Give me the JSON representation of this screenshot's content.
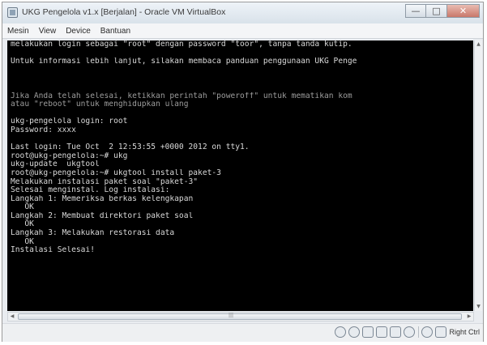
{
  "window": {
    "title": "UKG Pengelola v1.x [Berjalan] - Oracle VM VirtualBox",
    "minimize_icon": "minimize-icon",
    "maximize_icon": "maximize-icon",
    "close_icon": "close-icon"
  },
  "menu": {
    "items": [
      "Mesin",
      "View",
      "Device",
      "Bantuan"
    ]
  },
  "terminal": {
    "lines": [
      "melakukan login sebagai \"root\" dengan password \"toor\", tanpa tanda kutip.",
      "",
      "Untuk informasi lebih lanjut, silakan membaca panduan penggunaan UKG Penge",
      "",
      "",
      "",
      "Jika Anda telah selesai, ketikkan perintah \"poweroff\" untuk mematikan kom",
      "atau \"reboot\" untuk menghidupkan ulang",
      "",
      "ukg-pengelola login: root",
      "Password: xxxx",
      "",
      "Last login: Tue Oct  2 12:53:55 +0000 2012 on tty1.",
      "root@ukg-pengelola:~# ukg",
      "ukg-update  ukgtool",
      "root@ukg-pengelola:~# ukgtool install paket-3",
      "Melakukan instalasi paket soal \"paket-3\"",
      "Selesai menginstal. Log instalasi:",
      "Langkah 1: Memeriksa berkas kelengkapan",
      "   OK",
      "Langkah 2: Membuat direktori paket soal",
      "   OK",
      "Langkah 3: Melakukan restorasi data",
      "   OK",
      "Instalasi Selesai!"
    ]
  },
  "statusbar": {
    "host_key_label": "Right Ctrl",
    "icons": [
      "hard-disk-icon",
      "optical-drive-icon",
      "usb-icon",
      "network-icon",
      "shared-folder-icon",
      "capture-icon",
      "mouse-integration-icon",
      "keyboard-capture-icon"
    ]
  }
}
